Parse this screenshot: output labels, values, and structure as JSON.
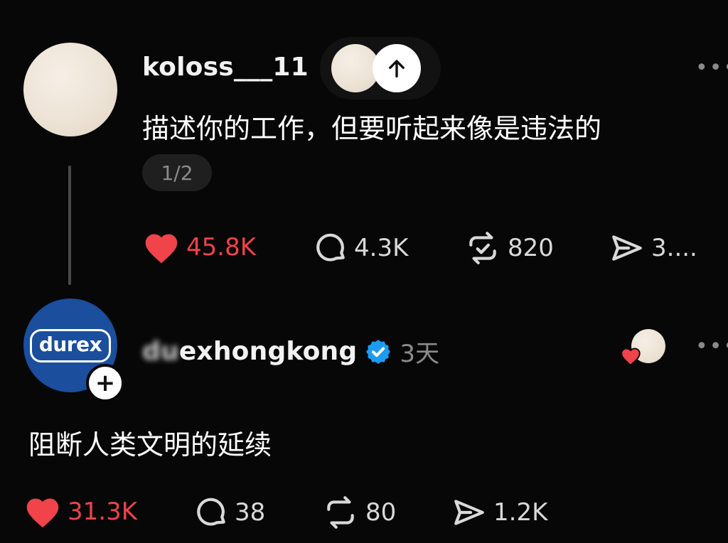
{
  "post": {
    "username": "koloss___11",
    "text": "描述你的工作，但要听起来像是违法的",
    "pager": "1/2",
    "more_icon": "more-horizontal-icon",
    "actions": {
      "likes": "45.8K",
      "comments": "4.3K",
      "reposts": "820",
      "shares": "3...."
    }
  },
  "reply": {
    "username_hidden": "du",
    "username_visible": "exhongkong",
    "avatar_logo": "durex",
    "time": "3天",
    "text": "阻断人类文明的延续",
    "actions": {
      "likes": "31.3K",
      "comments": "38",
      "reposts": "80",
      "shares": "1.2K"
    }
  },
  "colors": {
    "background": "#070707",
    "like_red": "#f0434a",
    "verified_blue": "#1d9bf0",
    "durex_blue": "#1b4e9c"
  }
}
